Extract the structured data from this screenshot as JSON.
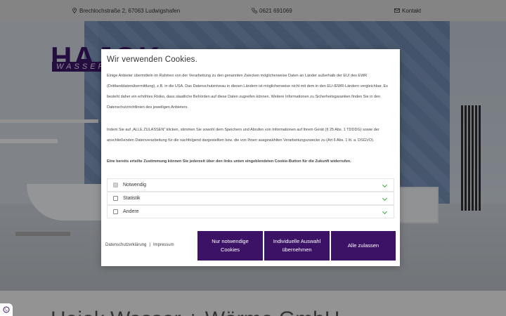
{
  "topbar": {
    "address": "Brechlochstraße 2, 67063 Ludwigshafen",
    "phone": "0621 691069",
    "contact": "Kontakt"
  },
  "hero": {
    "logo_main": "HAJOK",
    "logo_sub": "WASSER + W",
    "heading": "Hajok Wasser + Wärme GmbH"
  },
  "modal": {
    "title": "Wir verwenden Cookies.",
    "para1": "Einige Anbieter übermitteln im Rahmen von der Verarbeitung zu den genannten Zwecken möglicherweise Daten an Länder außerhalb der EU/ des EWR (Drittlanddatenübermittlung), z.B. in die USA. Das Datenschutzniveau in diesen Ländern ist möglicherweise nicht mit dem in den EU-/EWR-Ländern vergleichbar. Es besteht daher ein erhöhtes Risiko, dass staatliche Behörden auf diese Daten zugreifen können. Weitere Informationen zu Sicherheitsgarantien finden Sie in den Datenschutzrichtlinien des jeweiligen Anbieters.",
    "para2": "Indem Sie auf „ALLE ZULASSEN\" klicken, stimmen Sie sowohl dem Speichern und Abrufen von Informationen auf Ihrem Gerät (§ 25 Abs. 1 TDDDG) sowie der anschließenden Datenverarbeitung für die nachfolgend dargestellten bzw. die von Ihnen ausgewählten Verarbeitungszwecke zu (Art 6 Abs. 1 lit. a. DSGVO).",
    "para3": "Eine bereits erteilte Zustimmung können Sie jederzeit über den links unten eingeblendeten Cookie-Button für die Zukunft widerrufen.",
    "categories": [
      {
        "label": "Notwendig",
        "checked": true
      },
      {
        "label": "Statistik",
        "checked": false
      },
      {
        "label": "Andere",
        "checked": false
      }
    ],
    "links": {
      "privacy": "Datenschutzerklärung",
      "separator": "|",
      "imprint": "Impressum"
    },
    "buttons": {
      "necessary": "Nur notwendige Cookies",
      "individual": "Individuelle Auswahl übernehmen",
      "all": "Alle zulassen"
    }
  },
  "colors": {
    "primary": "#3c1266",
    "chevron": "#4caf50"
  },
  "icons": {
    "address": "map-pin-icon",
    "phone": "phone-icon",
    "contact": "envelope-icon",
    "cookie": "cookie-icon",
    "expand": "chevron-down-icon"
  }
}
